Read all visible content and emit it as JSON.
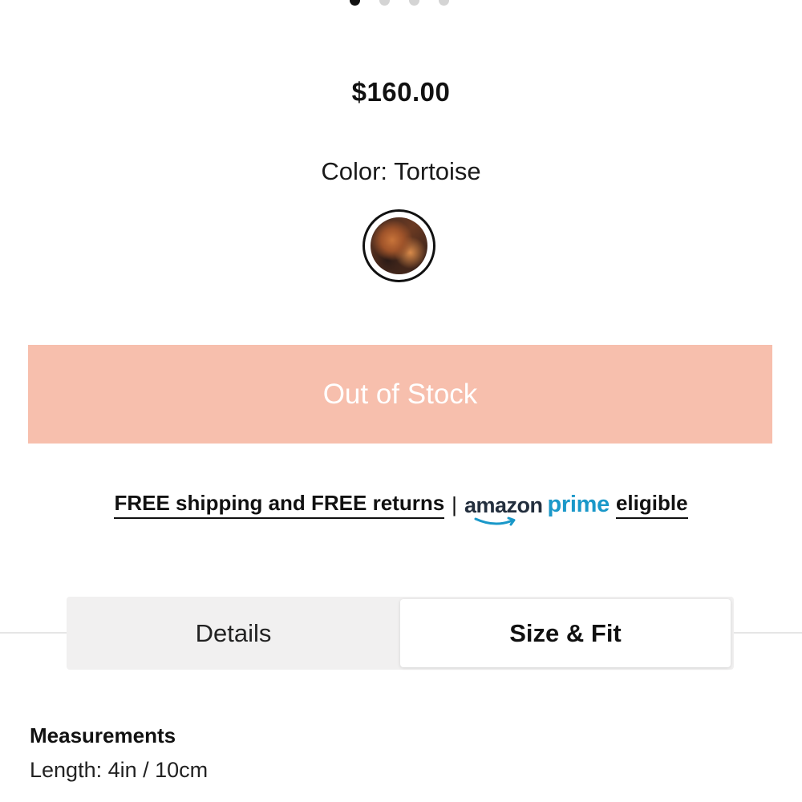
{
  "carousel": {
    "dot_count": 4,
    "active_index": 0
  },
  "product": {
    "price": "$160.00",
    "color_label": "Color: Tortoise",
    "swatch_name": "Tortoise"
  },
  "purchase": {
    "button_label": "Out of Stock",
    "button_color": "#f7bfad"
  },
  "shipping": {
    "text": "FREE shipping and FREE returns",
    "separator": "|",
    "amazon_word": "amazon",
    "prime_word": "prime",
    "eligible": "eligible",
    "prime_color": "#1a98c9",
    "amazon_color": "#232f3e"
  },
  "tabs": [
    {
      "label": "Details",
      "selected": false
    },
    {
      "label": "Size & Fit",
      "selected": true
    }
  ],
  "measurements": {
    "title": "Measurements",
    "length": "Length: 4in / 10cm"
  }
}
